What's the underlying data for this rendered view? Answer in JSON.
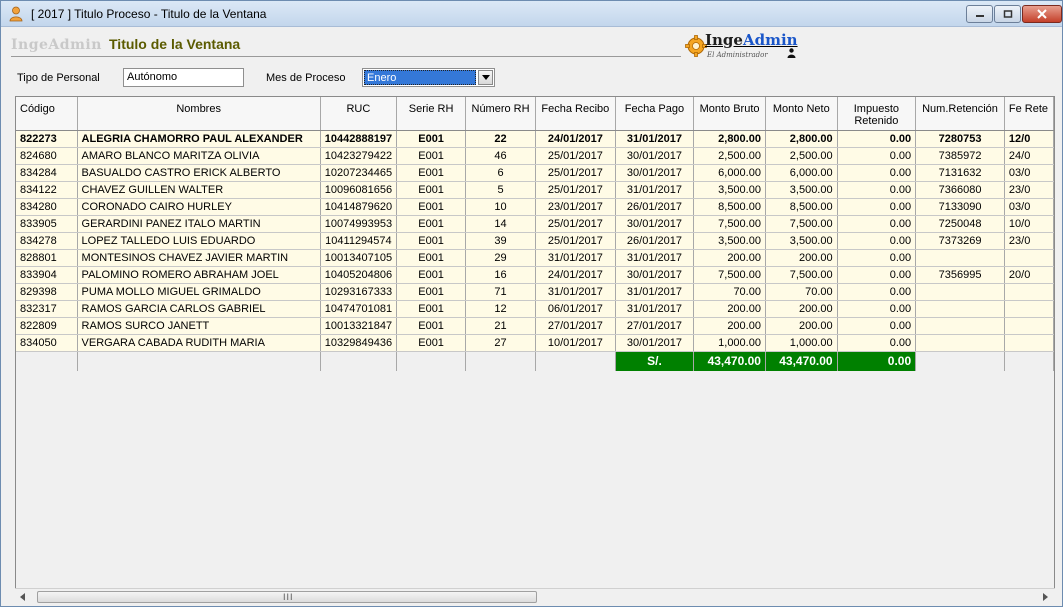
{
  "window": {
    "title": "[ 2017 ] Titulo Proceso - Titulo de la Ventana"
  },
  "header": {
    "brand_gray": "IngeAdmin",
    "form_title": "Titulo de la Ventana",
    "logo_part1": "Inge",
    "logo_part2": "Admin",
    "logo_subtitle": "El Administrador"
  },
  "filters": {
    "tipo_label": "Tipo de Personal",
    "tipo_value": "Autónomo",
    "mes_label": "Mes de Proceso",
    "mes_value": "Enero"
  },
  "table": {
    "columns": [
      "Código",
      "Nombres",
      "RUC",
      "Serie RH",
      "Número RH",
      "Fecha Recibo",
      "Fecha Pago",
      "Monto Bruto",
      "Monto Neto",
      "Impuesto Retenido",
      "Num.Retención",
      "Fe Rete"
    ],
    "rows": [
      [
        "822273",
        "ALEGRIA CHAMORRO PAUL ALEXANDER",
        "10442888197",
        "E001",
        "22",
        "24/01/2017",
        "31/01/2017",
        "2,800.00",
        "2,800.00",
        "0.00",
        "7280753",
        "12/0"
      ],
      [
        "824680",
        "AMARO BLANCO MARITZA OLIVIA",
        "10423279422",
        "E001",
        "46",
        "25/01/2017",
        "30/01/2017",
        "2,500.00",
        "2,500.00",
        "0.00",
        "7385972",
        "24/0"
      ],
      [
        "834284",
        "BASUALDO CASTRO ERICK ALBERTO",
        "10207234465",
        "E001",
        "6",
        "25/01/2017",
        "30/01/2017",
        "6,000.00",
        "6,000.00",
        "0.00",
        "7131632",
        "03/0"
      ],
      [
        "834122",
        "CHAVEZ GUILLEN WALTER",
        "10096081656",
        "E001",
        "5",
        "25/01/2017",
        "31/01/2017",
        "3,500.00",
        "3,500.00",
        "0.00",
        "7366080",
        "23/0"
      ],
      [
        "834280",
        "CORONADO CAIRO HURLEY",
        "10414879620",
        "E001",
        "10",
        "23/01/2017",
        "26/01/2017",
        "8,500.00",
        "8,500.00",
        "0.00",
        "7133090",
        "03/0"
      ],
      [
        "833905",
        "GERARDINI PANEZ ITALO MARTIN",
        "10074993953",
        "E001",
        "14",
        "25/01/2017",
        "30/01/2017",
        "7,500.00",
        "7,500.00",
        "0.00",
        "7250048",
        "10/0"
      ],
      [
        "834278",
        "LOPEZ TALLEDO LUIS EDUARDO",
        "10411294574",
        "E001",
        "39",
        "25/01/2017",
        "26/01/2017",
        "3,500.00",
        "3,500.00",
        "0.00",
        "7373269",
        "23/0"
      ],
      [
        "828801",
        "MONTESINOS CHAVEZ JAVIER MARTIN",
        "10013407105",
        "E001",
        "29",
        "31/01/2017",
        "31/01/2017",
        "200.00",
        "200.00",
        "0.00",
        "",
        ""
      ],
      [
        "833904",
        "PALOMINO ROMERO ABRAHAM JOEL",
        "10405204806",
        "E001",
        "16",
        "24/01/2017",
        "30/01/2017",
        "7,500.00",
        "7,500.00",
        "0.00",
        "7356995",
        "20/0"
      ],
      [
        "829398",
        "PUMA MOLLO MIGUEL GRIMALDO",
        "10293167333",
        "E001",
        "71",
        "31/01/2017",
        "31/01/2017",
        "70.00",
        "70.00",
        "0.00",
        "",
        ""
      ],
      [
        "832317",
        "RAMOS GARCIA CARLOS GABRIEL",
        "10474701081",
        "E001",
        "12",
        "06/01/2017",
        "31/01/2017",
        "200.00",
        "200.00",
        "0.00",
        "",
        ""
      ],
      [
        "822809",
        "RAMOS SURCO JANETT",
        "10013321847",
        "E001",
        "21",
        "27/01/2017",
        "27/01/2017",
        "200.00",
        "200.00",
        "0.00",
        "",
        ""
      ],
      [
        "834050",
        "VERGARA CABADA RUDITH MARIA",
        "10329849436",
        "E001",
        "27",
        "10/01/2017",
        "30/01/2017",
        "1,000.00",
        "1,000.00",
        "0.00",
        "",
        ""
      ]
    ],
    "totals": {
      "currency": "S/.",
      "monto_bruto": "43,470.00",
      "monto_neto": "43,470.00",
      "impuesto": "0.00"
    }
  },
  "scrollbar": {
    "grip": "III"
  },
  "colors": {
    "total_bg": "#008000",
    "row_bg": "#fffbe6",
    "select_highlight": "#3478d8"
  }
}
